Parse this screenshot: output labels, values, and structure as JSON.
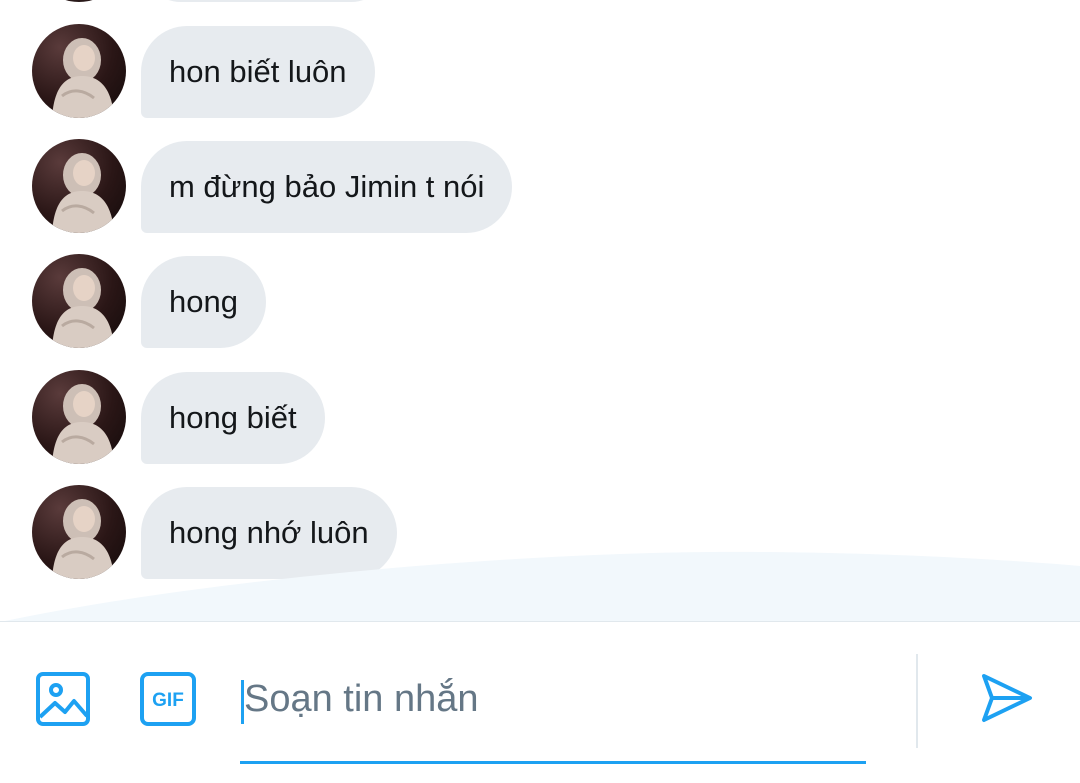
{
  "conversation": {
    "messages": [
      {
        "text": "hon biết luôn"
      },
      {
        "text": "m đừng bảo Jimin t nói"
      },
      {
        "text": "hong"
      },
      {
        "text": "hong biết"
      },
      {
        "text": "hong nhớ luôn"
      }
    ]
  },
  "composer": {
    "placeholder": "Soạn tin nhắn",
    "media_icon": "image-icon",
    "gif_icon": "gif-icon",
    "send_icon": "send-icon"
  },
  "colors": {
    "accent": "#1da1f2",
    "bubble": "#e7ebef",
    "text": "#14171a",
    "placeholder": "#657786"
  }
}
